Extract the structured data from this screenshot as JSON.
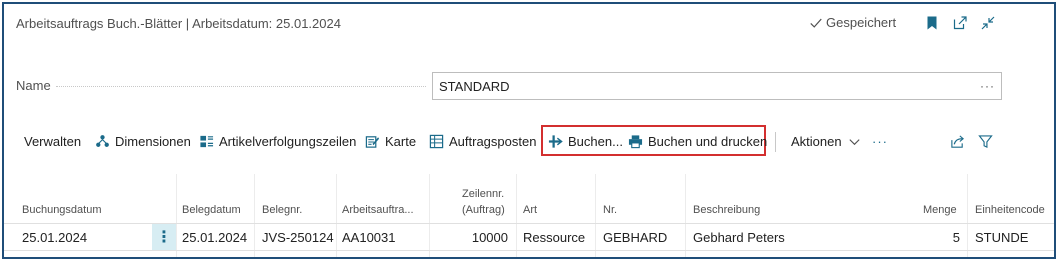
{
  "header": {
    "title": "Arbeitsauftrags Buch.-Blätter | Arbeitsdatum: 25.01.2024",
    "saved_label": "Gespeichert"
  },
  "name_field": {
    "label": "Name",
    "value": "STANDARD",
    "ellipsis": "···"
  },
  "actions": {
    "verwalten": "Verwalten",
    "dimensionen": "Dimensionen",
    "artikelverfolgung": "Artikelverfolgungszeilen",
    "karte": "Karte",
    "auftragsposten": "Auftragsposten",
    "buchen": "Buchen...",
    "buchen_drucken": "Buchen und drucken",
    "aktionen": "Aktionen",
    "more": "···"
  },
  "table": {
    "columns": {
      "buchungsdatum": "Buchungsdatum",
      "belegdatum": "Belegdatum",
      "belegnr": "Belegnr.",
      "arbeitsauftrag": "Arbeitsauftra...",
      "zeilennr_1": "Zeilennr.",
      "zeilennr_2": "(Auftrag)",
      "art": "Art",
      "nr": "Nr.",
      "beschreibung": "Beschreibung",
      "menge": "Menge",
      "einheitencode": "Einheitencode"
    },
    "row": {
      "buchungsdatum": "25.01.2024",
      "handle": "⋮",
      "belegdatum": "25.01.2024",
      "belegnr": "JVS-250124",
      "arbeitsauftrag": "AA10031",
      "zeilennr": "10000",
      "art": "Ressource",
      "nr": "GEBHARD",
      "beschreibung": "Gebhard Peters",
      "menge": "5",
      "einheitencode": "STUNDE"
    }
  },
  "colors": {
    "accent": "#1b6b8a",
    "frame": "#1f4e79",
    "highlight": "#d32f2f"
  }
}
